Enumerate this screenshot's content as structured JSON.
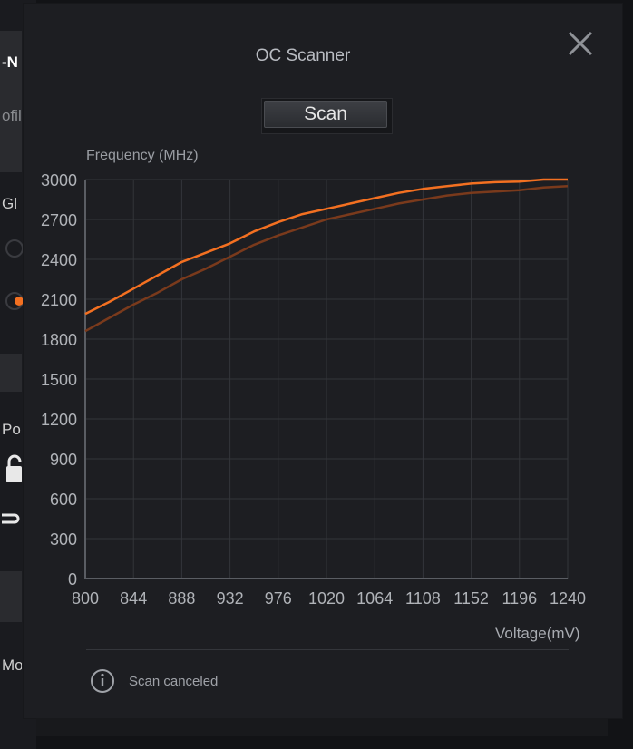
{
  "background_app": {
    "fragments": [
      "-N",
      "ofile",
      "Gl",
      "Po",
      "Mo"
    ]
  },
  "dialog": {
    "title": "OC Scanner",
    "scan_button": "Scan",
    "close_icon": "close-icon",
    "status_icon": "info-icon",
    "status_text": "Scan canceled"
  },
  "colors": {
    "accent": "#f37021",
    "secondary_curve": "#7a3a1c",
    "background": "#1d1e22",
    "grid": "#33353a"
  },
  "chart_data": {
    "type": "line",
    "ylabel": "Frequency (MHz)",
    "xlabel": "Voltage(mV)",
    "xlim": [
      800,
      1240
    ],
    "ylim": [
      0,
      3000
    ],
    "x_ticks": [
      800,
      844,
      888,
      932,
      976,
      1020,
      1064,
      1108,
      1152,
      1196,
      1240
    ],
    "y_ticks": [
      0,
      300,
      600,
      900,
      1200,
      1500,
      1800,
      2100,
      2400,
      2700,
      3000
    ],
    "grid": true,
    "series": [
      {
        "color": "#f37021",
        "x": [
          800,
          822,
          844,
          866,
          888,
          910,
          932,
          954,
          976,
          998,
          1020,
          1042,
          1064,
          1086,
          1108,
          1130,
          1152,
          1174,
          1196,
          1218,
          1240
        ],
        "y": [
          1990,
          2080,
          2180,
          2280,
          2380,
          2450,
          2520,
          2610,
          2680,
          2740,
          2780,
          2820,
          2860,
          2900,
          2930,
          2950,
          2970,
          2980,
          2985,
          3000,
          3000
        ]
      },
      {
        "color": "#7a3a1c",
        "x": [
          800,
          822,
          844,
          866,
          888,
          910,
          932,
          954,
          976,
          998,
          1020,
          1042,
          1064,
          1086,
          1108,
          1130,
          1152,
          1174,
          1196,
          1218,
          1240
        ],
        "y": [
          1860,
          1960,
          2060,
          2150,
          2250,
          2330,
          2420,
          2510,
          2580,
          2640,
          2700,
          2740,
          2780,
          2820,
          2850,
          2880,
          2900,
          2910,
          2920,
          2940,
          2950
        ]
      }
    ]
  }
}
